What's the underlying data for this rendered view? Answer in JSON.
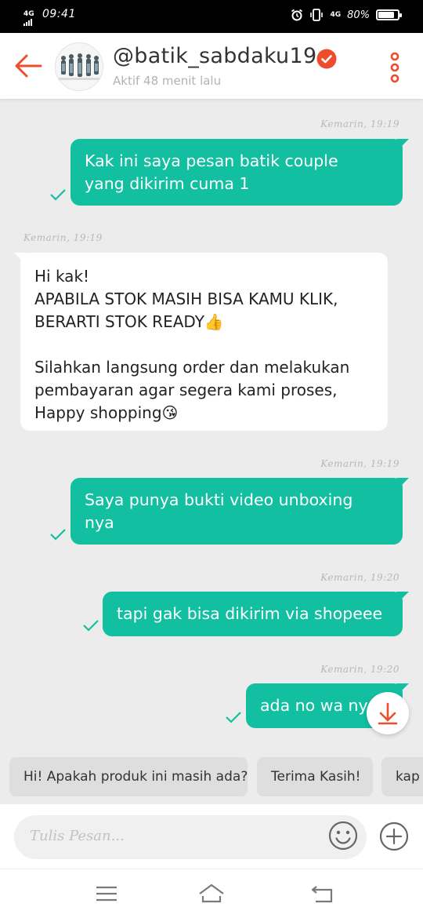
{
  "status_bar": {
    "network": "4G",
    "time": "09:41",
    "network_right": "4G",
    "battery": "80%"
  },
  "header": {
    "shop_name": "@batik_sabdaku19",
    "status": "Aktif 48 menit lalu",
    "accent_color": "#ee4d2d"
  },
  "messages": [
    {
      "from": "me",
      "time": "Kemarin, 19:19",
      "text": "Kak ini saya pesan batik couple\nyang dikirim cuma 1"
    },
    {
      "from": "shop",
      "time": "Kemarin, 19:19",
      "text": "Hi kak!\nAPABILA STOK MASIH BISA KAMU KLIK,\nBERARTI STOK READY👍\n\nSilahkan langsung order dan melakukan\npembayaran agar segera kami proses,\nHappy shopping😘"
    },
    {
      "from": "me",
      "time": "Kemarin, 19:19",
      "text": "Saya punya bukti video unboxing\nnya"
    },
    {
      "from": "me",
      "time": "Kemarin, 19:20",
      "text": "tapi gak bisa dikirim via shopeee"
    },
    {
      "from": "me",
      "time": "Kemarin, 19:20",
      "text": "ada no wa nya"
    }
  ],
  "quick_replies": [
    "Hi! Apakah produk ini masih ada?",
    "Terima Kasih!",
    "kap"
  ],
  "input": {
    "placeholder": "Tulis Pesan..."
  },
  "colors": {
    "outgoing_bubble": "#12bfa0",
    "incoming_bubble": "#ffffff",
    "background": "#ececec"
  },
  "icons": [
    "back-arrow-icon",
    "verified-badge-icon",
    "more-vertical-icon",
    "check-icon",
    "scroll-down-icon",
    "emoji-icon",
    "plus-icon",
    "menu-icon",
    "home-icon",
    "back-icon"
  ]
}
